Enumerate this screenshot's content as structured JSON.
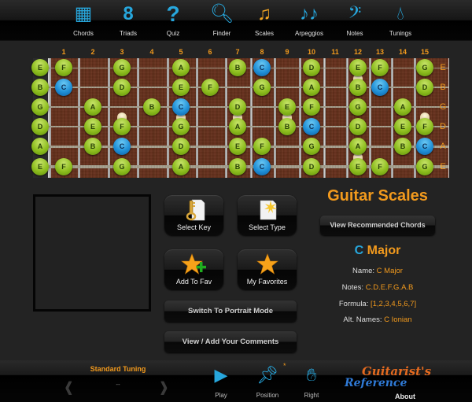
{
  "toolbar": {
    "items": [
      {
        "label": "Chords",
        "icon": "chord-grid-icon",
        "glyph": "▦",
        "active": false
      },
      {
        "label": "Triads",
        "icon": "triad-stack-icon",
        "glyph": "8",
        "active": false
      },
      {
        "label": "Quiz",
        "icon": "question-mark-icon",
        "glyph": "?",
        "active": false
      },
      {
        "label": "Finder",
        "icon": "magnifier-icon",
        "glyph": "🔍︎",
        "active": false
      },
      {
        "label": "Scales",
        "icon": "music-note-icon",
        "glyph": "♫",
        "active": true
      },
      {
        "label": "Arpeggios",
        "icon": "double-note-icon",
        "glyph": "♪♪",
        "active": false
      },
      {
        "label": "Notes",
        "icon": "bass-clef-icon",
        "glyph": "𝄢",
        "active": false
      },
      {
        "label": "Tunings",
        "icon": "droplet-icon",
        "glyph": "💧︎",
        "active": false
      }
    ]
  },
  "fretboard": {
    "fret_numbers": [
      "1",
      "2",
      "3",
      "4",
      "5",
      "6",
      "7",
      "8",
      "9",
      "10",
      "11",
      "12",
      "13",
      "14",
      "15"
    ],
    "string_labels": [
      "E",
      "B",
      "G",
      "D",
      "A",
      "E"
    ],
    "root_color": "#1f8fd6",
    "note_color": "#8dbd1e",
    "inlays": [
      {
        "fret": 3,
        "position": "G-D"
      },
      {
        "fret": 5,
        "position": "G-D"
      },
      {
        "fret": 7,
        "position": "G-D"
      },
      {
        "fret": 9,
        "position": "G-D"
      },
      {
        "fret": 12,
        "position": "E-B"
      },
      {
        "fret": 12,
        "position": "A-E"
      },
      {
        "fret": 15,
        "position": "G-D"
      }
    ],
    "strings": [
      {
        "name": "E",
        "notes": [
          {
            "fret": 0,
            "note": "E"
          },
          {
            "fret": 1,
            "note": "F"
          },
          {
            "fret": 3,
            "note": "G"
          },
          {
            "fret": 5,
            "note": "A"
          },
          {
            "fret": 7,
            "note": "B"
          },
          {
            "fret": 8,
            "note": "C",
            "root": true
          },
          {
            "fret": 10,
            "note": "D"
          },
          {
            "fret": 12,
            "note": "E"
          },
          {
            "fret": 13,
            "note": "F"
          },
          {
            "fret": 15,
            "note": "G"
          }
        ]
      },
      {
        "name": "B",
        "notes": [
          {
            "fret": 0,
            "note": "B"
          },
          {
            "fret": 1,
            "note": "C",
            "root": true
          },
          {
            "fret": 3,
            "note": "D"
          },
          {
            "fret": 5,
            "note": "E"
          },
          {
            "fret": 6,
            "note": "F"
          },
          {
            "fret": 8,
            "note": "G"
          },
          {
            "fret": 10,
            "note": "A"
          },
          {
            "fret": 12,
            "note": "B"
          },
          {
            "fret": 13,
            "note": "C",
            "root": true
          },
          {
            "fret": 15,
            "note": "D"
          }
        ]
      },
      {
        "name": "G",
        "notes": [
          {
            "fret": 0,
            "note": "G"
          },
          {
            "fret": 2,
            "note": "A"
          },
          {
            "fret": 4,
            "note": "B"
          },
          {
            "fret": 5,
            "note": "C",
            "root": true
          },
          {
            "fret": 7,
            "note": "D"
          },
          {
            "fret": 9,
            "note": "E"
          },
          {
            "fret": 10,
            "note": "F"
          },
          {
            "fret": 12,
            "note": "G"
          },
          {
            "fret": 14,
            "note": "A"
          }
        ]
      },
      {
        "name": "D",
        "notes": [
          {
            "fret": 0,
            "note": "D"
          },
          {
            "fret": 2,
            "note": "E"
          },
          {
            "fret": 3,
            "note": "F"
          },
          {
            "fret": 5,
            "note": "G"
          },
          {
            "fret": 7,
            "note": "A"
          },
          {
            "fret": 9,
            "note": "B"
          },
          {
            "fret": 10,
            "note": "C",
            "root": true
          },
          {
            "fret": 12,
            "note": "D"
          },
          {
            "fret": 14,
            "note": "E"
          },
          {
            "fret": 15,
            "note": "F"
          }
        ]
      },
      {
        "name": "A",
        "notes": [
          {
            "fret": 0,
            "note": "A"
          },
          {
            "fret": 2,
            "note": "B"
          },
          {
            "fret": 3,
            "note": "C",
            "root": true
          },
          {
            "fret": 5,
            "note": "D"
          },
          {
            "fret": 7,
            "note": "E"
          },
          {
            "fret": 8,
            "note": "F"
          },
          {
            "fret": 10,
            "note": "G"
          },
          {
            "fret": 12,
            "note": "A"
          },
          {
            "fret": 14,
            "note": "B"
          },
          {
            "fret": 15,
            "note": "C",
            "root": true
          }
        ]
      },
      {
        "name": "E",
        "notes": [
          {
            "fret": 0,
            "note": "E"
          },
          {
            "fret": 1,
            "note": "F"
          },
          {
            "fret": 3,
            "note": "G"
          },
          {
            "fret": 5,
            "note": "A"
          },
          {
            "fret": 7,
            "note": "B"
          },
          {
            "fret": 8,
            "note": "C",
            "root": true
          },
          {
            "fret": 10,
            "note": "D"
          },
          {
            "fret": 12,
            "note": "E"
          },
          {
            "fret": 13,
            "note": "F"
          },
          {
            "fret": 15,
            "note": "G"
          }
        ]
      }
    ]
  },
  "buttons": {
    "select_key": {
      "label": "Select Key",
      "icon": "key-document-icon"
    },
    "select_type": {
      "label": "Select Type",
      "icon": "starburst-document-icon"
    },
    "add_to_fav": {
      "label": "Add To Fav",
      "icon": "star-plus-icon"
    },
    "my_favorites": {
      "label": "My Favorites",
      "icon": "star-icon"
    },
    "switch_portrait": "Switch To Portrait Mode",
    "comments": "View / Add Your Comments",
    "recommended_chords": "View Recommended Chords"
  },
  "panel": {
    "title": "Guitar Scales",
    "scale_root": "C",
    "scale_type": "Major",
    "info": [
      {
        "label": "Name: ",
        "value": "C Major"
      },
      {
        "label": "Notes: ",
        "value": "C.D.E.F.G.A.B"
      },
      {
        "label": "Formula: ",
        "value": "[1,2,3,4,5,6,7]"
      },
      {
        "label": "Alt. Names: ",
        "value": "C Ionian"
      }
    ]
  },
  "bottombar": {
    "tuning_title": "Standard Tuning",
    "tuning_value": "--",
    "prev_glyph": "‹",
    "next_glyph": "›",
    "play": {
      "label": "Play",
      "glyph": "▶"
    },
    "position": {
      "label": "Position",
      "glyph": "📌︎"
    },
    "right": {
      "label": "Right",
      "glyph": "✋︎"
    },
    "asterisk": "*",
    "logo_top": "Guitarist's",
    "logo_bottom": "Reference",
    "about": "About"
  }
}
